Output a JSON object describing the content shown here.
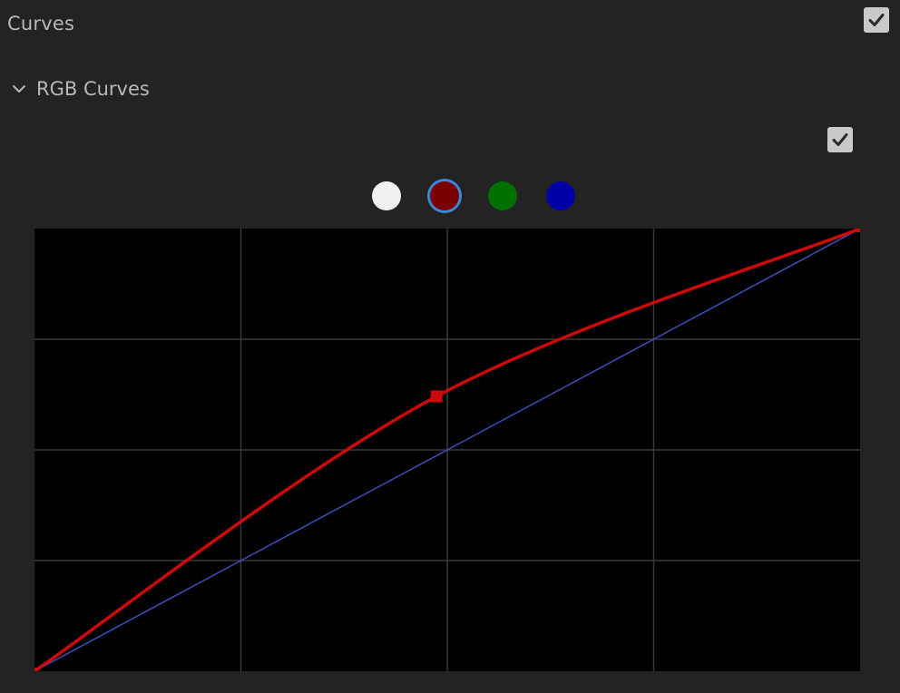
{
  "panel": {
    "title": "Curves",
    "enabled": true
  },
  "rgb_curves": {
    "label": "RGB Curves",
    "expanded": true,
    "enabled": true,
    "channels": [
      {
        "name": "master",
        "color": "#f0f0f0",
        "selected": false
      },
      {
        "name": "red",
        "color": "#7a0000",
        "selected": true
      },
      {
        "name": "green",
        "color": "#007000",
        "selected": false
      },
      {
        "name": "blue",
        "color": "#0000a8",
        "selected": false
      }
    ],
    "grid_divisions": 4,
    "colors": {
      "background": "#000000",
      "grid": "#3a3a3a",
      "reference_line": "#3a4fb8",
      "active_curve": "#cc0a0a",
      "selection_ring": "#3d86d8"
    },
    "curve": {
      "channel": "red",
      "points": [
        {
          "input": 0.0,
          "output": 0.0
        },
        {
          "input": 0.487,
          "output": 0.621
        },
        {
          "input": 1.0,
          "output": 1.0
        }
      ]
    },
    "reference": {
      "points": [
        {
          "input": 0.0,
          "output": 0.0
        },
        {
          "input": 1.0,
          "output": 1.0
        }
      ]
    }
  }
}
